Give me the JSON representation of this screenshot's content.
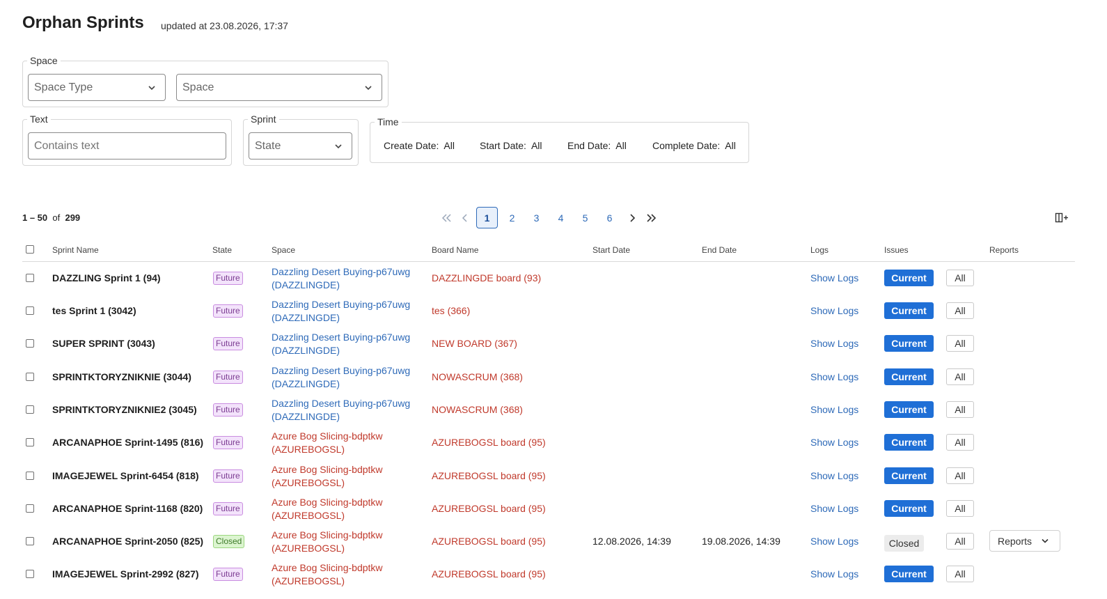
{
  "header": {
    "title": "Orphan Sprints",
    "updated": "updated at 23.08.2026, 17:37"
  },
  "filters": {
    "space_group": "Space",
    "space_type_placeholder": "Space Type",
    "space_placeholder": "Space",
    "text_group": "Text",
    "text_placeholder": "Contains text",
    "sprint_group": "Sprint",
    "state_placeholder": "State",
    "time_group": "Time",
    "time_items": [
      {
        "label": "Create Date:",
        "value": "All"
      },
      {
        "label": "Start Date:",
        "value": "All"
      },
      {
        "label": "End Date:",
        "value": "All"
      },
      {
        "label": "Complete Date:",
        "value": "All"
      }
    ]
  },
  "pagination": {
    "range": "1 – 50",
    "of": "of",
    "total": "299",
    "pages": [
      "1",
      "2",
      "3",
      "4",
      "5",
      "6"
    ],
    "active_page": "1"
  },
  "table": {
    "columns": [
      "Sprint Name",
      "State",
      "Space",
      "Board Name",
      "Start Date",
      "End Date",
      "Logs",
      "Issues",
      "Reports"
    ],
    "rows": [
      {
        "name": "DAZZLING Sprint 1 (94)",
        "state": "Future",
        "space_line1": "Dazzling Desert Buying-p67uwg",
        "space_line2": "(DAZZLINGDE)",
        "board": "DAZZLINGDE board (93)",
        "start": "",
        "end": "",
        "logs": "Show Logs",
        "issue_current": "Current",
        "issue_all": "All",
        "reports": ""
      },
      {
        "name": "tes Sprint 1 (3042)",
        "state": "Future",
        "space_line1": "Dazzling Desert Buying-p67uwg",
        "space_line2": "(DAZZLINGDE)",
        "board": "tes (366)",
        "start": "",
        "end": "",
        "logs": "Show Logs",
        "issue_current": "Current",
        "issue_all": "All",
        "reports": ""
      },
      {
        "name": "SUPER SPRINT (3043)",
        "state": "Future",
        "space_line1": "Dazzling Desert Buying-p67uwg",
        "space_line2": "(DAZZLINGDE)",
        "board": "NEW BOARD (367)",
        "start": "",
        "end": "",
        "logs": "Show Logs",
        "issue_current": "Current",
        "issue_all": "All",
        "reports": ""
      },
      {
        "name": "SPRINTKTORYZNIKNIE (3044)",
        "state": "Future",
        "space_line1": "Dazzling Desert Buying-p67uwg",
        "space_line2": "(DAZZLINGDE)",
        "board": "NOWASCRUM (368)",
        "start": "",
        "end": "",
        "logs": "Show Logs",
        "issue_current": "Current",
        "issue_all": "All",
        "reports": ""
      },
      {
        "name": "SPRINTKTORYZNIKNIE2 (3045)",
        "state": "Future",
        "space_line1": "Dazzling Desert Buying-p67uwg",
        "space_line2": "(DAZZLINGDE)",
        "board": "NOWASCRUM (368)",
        "start": "",
        "end": "",
        "logs": "Show Logs",
        "issue_current": "Current",
        "issue_all": "All",
        "reports": ""
      },
      {
        "name": "ARCANAPHOE Sprint-1495 (816)",
        "state": "Future",
        "space_line1": "Azure Bog Slicing-bdptkw",
        "space_line2": "(AZUREBOGSL)",
        "board": "AZUREBOGSL board (95)",
        "start": "",
        "end": "",
        "logs": "Show Logs",
        "issue_current": "Current",
        "issue_all": "All",
        "reports": ""
      },
      {
        "name": "IMAGEJEWEL Sprint-6454 (818)",
        "state": "Future",
        "space_line1": "Azure Bog Slicing-bdptkw",
        "space_line2": "(AZUREBOGSL)",
        "board": "AZUREBOGSL board (95)",
        "start": "",
        "end": "",
        "logs": "Show Logs",
        "issue_current": "Current",
        "issue_all": "All",
        "reports": ""
      },
      {
        "name": "ARCANAPHOE Sprint-1168 (820)",
        "state": "Future",
        "space_line1": "Azure Bog Slicing-bdptkw",
        "space_line2": "(AZUREBOGSL)",
        "board": "AZUREBOGSL board (95)",
        "start": "",
        "end": "",
        "logs": "Show Logs",
        "issue_current": "Current",
        "issue_all": "All",
        "reports": ""
      },
      {
        "name": "ARCANAPHOE Sprint-2050 (825)",
        "state": "Closed",
        "space_line1": "Azure Bog Slicing-bdptkw",
        "space_line2": "(AZUREBOGSL)",
        "board": "AZUREBOGSL board (95)",
        "start": "12.08.2026, 14:39",
        "end": "19.08.2026, 14:39",
        "logs": "Show Logs",
        "issue_current": "Closed",
        "issue_all": "All",
        "reports": "Reports"
      },
      {
        "name": "IMAGEJEWEL Sprint-2992 (827)",
        "state": "Future",
        "space_line1": "Azure Bog Slicing-bdptkw",
        "space_line2": "(AZUREBOGSL)",
        "board": "AZUREBOGSL board (95)",
        "start": "",
        "end": "",
        "logs": "Show Logs",
        "issue_current": "Current",
        "issue_all": "All",
        "reports": ""
      }
    ]
  },
  "colors": {
    "link_blue": "#2e6ab8",
    "board_red": "#c0392b",
    "current_button": "#1f6fd6",
    "future_badge": "#f3e3fb",
    "closed_badge": "#dcf5d0"
  }
}
